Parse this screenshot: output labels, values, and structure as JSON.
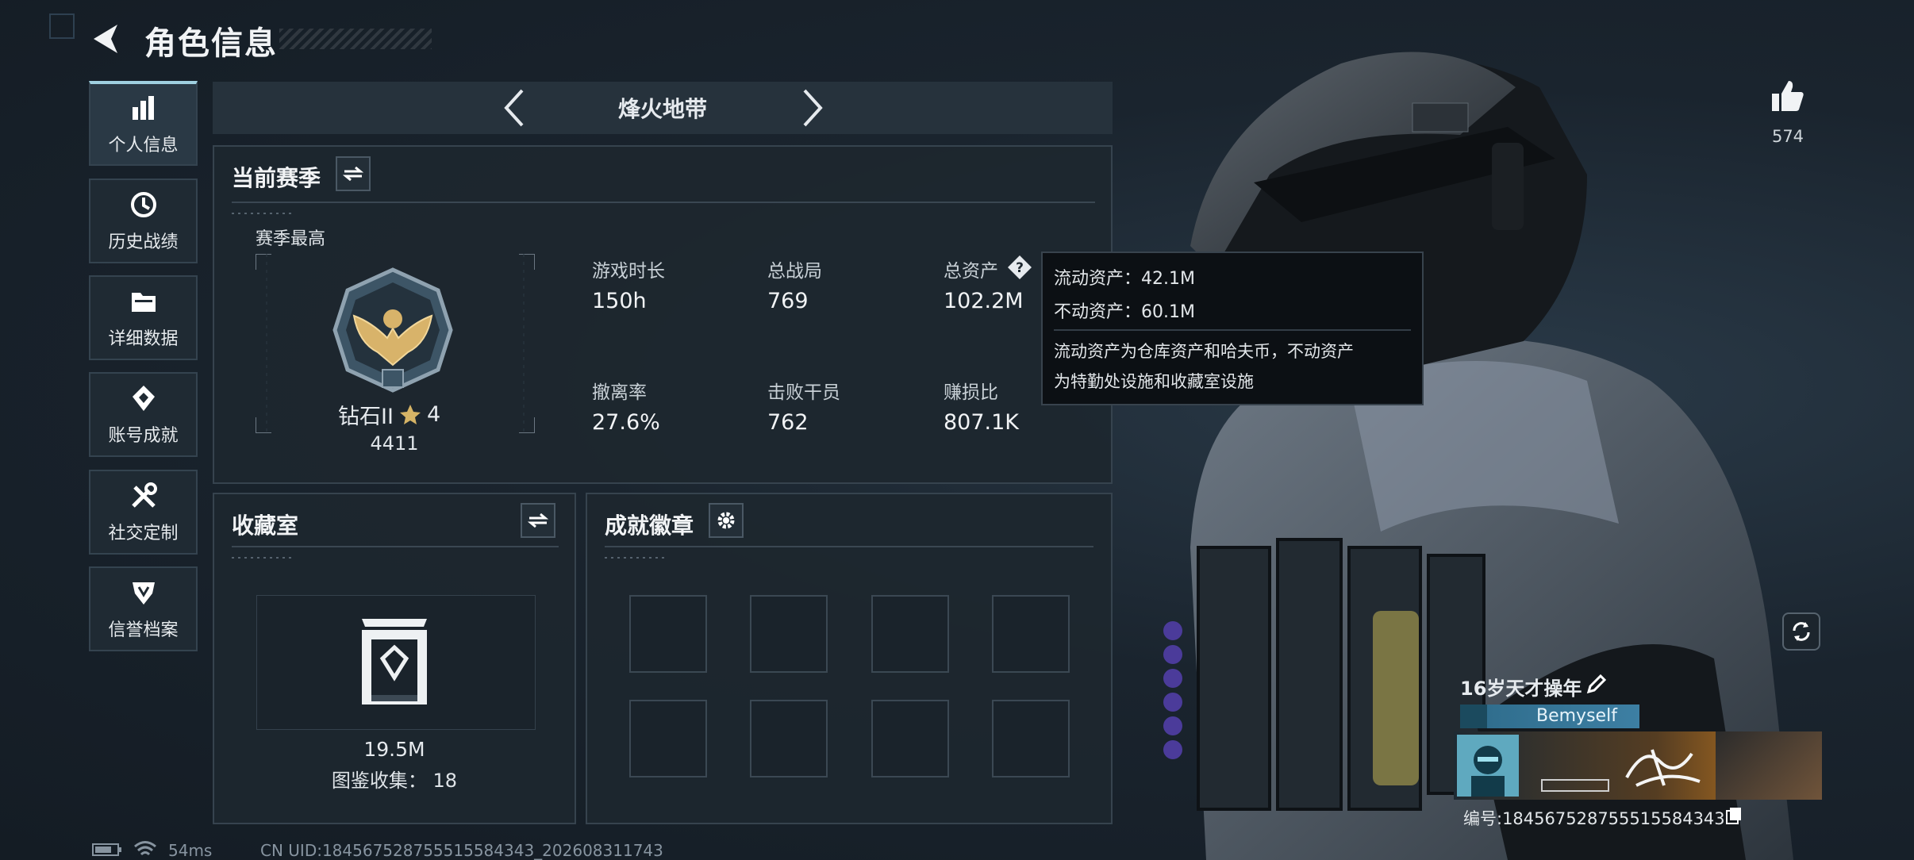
{
  "header": {
    "title": "角色信息",
    "back_icon": "back-arrow-icon"
  },
  "sidebar": {
    "items": [
      {
        "label": "个人信息",
        "icon": "bar-chart-icon",
        "active": true
      },
      {
        "label": "历史战绩",
        "icon": "history-icon"
      },
      {
        "label": "详细数据",
        "icon": "folder-icon"
      },
      {
        "label": "账号成就",
        "icon": "achievement-icon"
      },
      {
        "label": "社交定制",
        "icon": "tools-icon"
      },
      {
        "label": "信誉档案",
        "icon": "shield-badge-icon"
      }
    ]
  },
  "mode_tab": {
    "label": "烽火地带"
  },
  "season": {
    "title": "当前赛季",
    "best_label": "赛季最高",
    "rank_name": "钻石II",
    "rank_stars": "4",
    "rank_points": "4411",
    "stats": [
      {
        "label": "游戏时长",
        "value": "150h"
      },
      {
        "label": "总战局",
        "value": "769"
      },
      {
        "label": "总资产",
        "value": "102.2M"
      },
      {
        "label": "撤离率",
        "value": "27.6%"
      },
      {
        "label": "击败干员",
        "value": "762"
      },
      {
        "label": "赚损比",
        "value": "807.1K"
      }
    ]
  },
  "asset_tooltip": {
    "liquid": "流动资产：42.1M",
    "fixed": "不动资产：60.1M",
    "desc1": "流动资产为仓库资产和哈夫币，不动资产",
    "desc2": "为特勤处设施和收藏室设施"
  },
  "collection": {
    "title": "收藏室",
    "value": "19.5M",
    "catalog": "图鉴收集： 18"
  },
  "badges": {
    "title": "成就徽章",
    "slots": 8
  },
  "profile": {
    "likes": "574",
    "nickname": "16岁天才操年",
    "tag": "Bemyself",
    "id_text": "编号:18456752875551558434​3"
  },
  "status": {
    "ping": "54ms",
    "uid": "CN UID:184567528755515584343_202608311743"
  },
  "colors": {
    "accent": "#9fd0e0",
    "panel": "#1d272f",
    "border": "#36434e"
  }
}
